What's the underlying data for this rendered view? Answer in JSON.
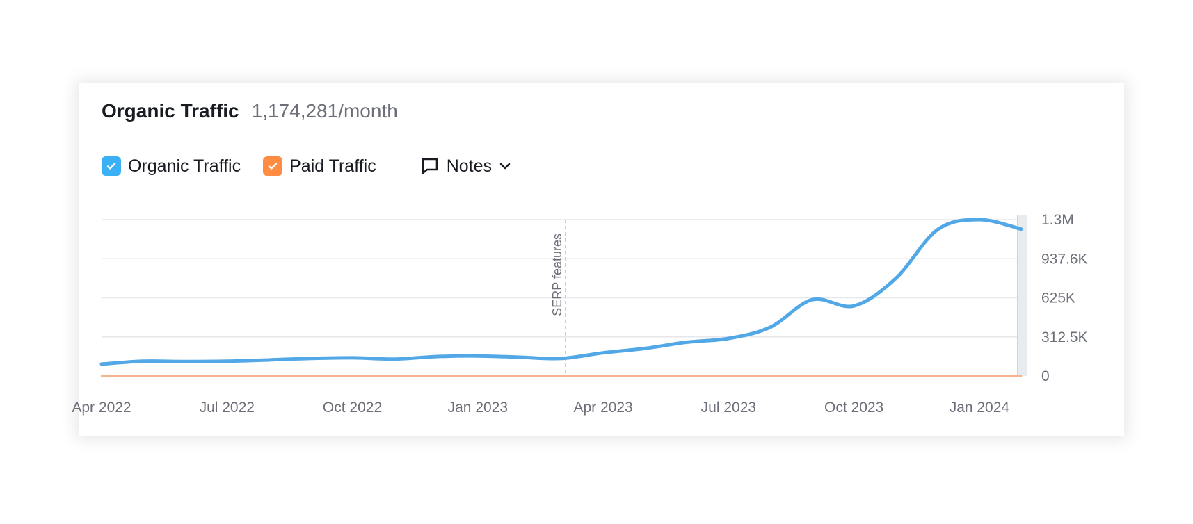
{
  "header": {
    "title": "Organic Traffic",
    "metric": "1,174,281/month"
  },
  "legend": {
    "items": [
      {
        "label": "Organic Traffic",
        "color": "#3ab0f5",
        "checked": true
      },
      {
        "label": "Paid Traffic",
        "color": "#ff8c42",
        "checked": true
      }
    ],
    "notes_label": "Notes"
  },
  "chart_data": {
    "type": "line",
    "title": "Organic Traffic",
    "xlabel": "",
    "ylabel": "",
    "x_ticks": [
      "Apr 2022",
      "Jul 2022",
      "Oct 2022",
      "Jan 2023",
      "Apr 2023",
      "Jul 2023",
      "Oct 2023",
      "Jan 2024"
    ],
    "y_ticks": [
      "0",
      "312.5K",
      "625K",
      "937.6K",
      "1.3M"
    ],
    "ylim": [
      0,
      1250000
    ],
    "grid": true,
    "legend_position": "top-left",
    "annotations": [
      {
        "label": "SERP features",
        "x": "Mar 2023"
      }
    ],
    "x": [
      "Apr 2022",
      "May 2022",
      "Jun 2022",
      "Jul 2022",
      "Aug 2022",
      "Sep 2022",
      "Oct 2022",
      "Nov 2022",
      "Dec 2022",
      "Jan 2023",
      "Feb 2023",
      "Mar 2023",
      "Apr 2023",
      "May 2023",
      "Jun 2023",
      "Jul 2023",
      "Aug 2023",
      "Sep 2023",
      "Oct 2023",
      "Nov 2023",
      "Dec 2023",
      "Jan 2024",
      "Feb 2024"
    ],
    "series": [
      {
        "name": "Organic Traffic",
        "color": "#52a8e6",
        "values": [
          95000,
          118000,
          115000,
          118000,
          128000,
          140000,
          145000,
          135000,
          155000,
          160000,
          150000,
          140000,
          185000,
          220000,
          270000,
          300000,
          390000,
          610000,
          560000,
          780000,
          1170000,
          1250000,
          1174281
        ]
      },
      {
        "name": "Paid Traffic",
        "color": "#f7b48c",
        "values": [
          0,
          0,
          0,
          0,
          0,
          0,
          0,
          0,
          0,
          0,
          0,
          0,
          0,
          0,
          0,
          0,
          0,
          0,
          0,
          0,
          0,
          0,
          0
        ]
      }
    ]
  }
}
